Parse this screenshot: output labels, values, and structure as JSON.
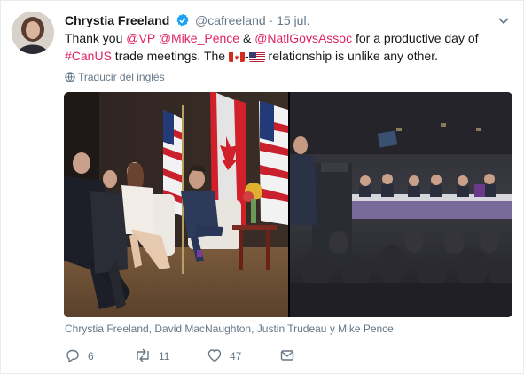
{
  "author": {
    "name": "Chrystia Freeland",
    "handle": "@cafreeland",
    "dot": "·",
    "date": "15 jul."
  },
  "tweet": {
    "t1": "Thank you ",
    "m1": "@VP",
    "t2": " ",
    "m2": "@Mike_Pence",
    "t3": " & ",
    "m3": "@NatlGovsAssoc",
    "t4": " for a productive day of",
    "hashtag": "#CanUS",
    "t5": " trade meetings. The ",
    "t6": "-",
    "t7": " relationship is unlike any other."
  },
  "translate_label": "Traducir del inglés",
  "caption": "Chrystia Freeland, David MacNaughton, Justin Trudeau y Mike Pence",
  "actions": {
    "replies": "6",
    "retweets": "11",
    "likes": "47"
  },
  "colors": {
    "link": "#e0245e",
    "muted": "#657786",
    "verified": "#1da1f2"
  }
}
